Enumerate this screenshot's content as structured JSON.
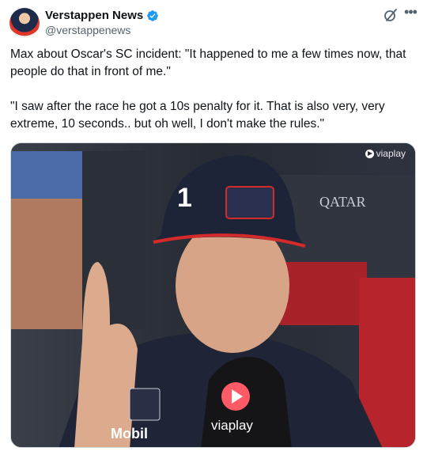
{
  "author": {
    "name": "Verstappen News",
    "handle": "@verstappenews",
    "verified": true
  },
  "icons": {
    "verified": "verified-badge-icon",
    "grok": "grok-icon",
    "more": "more-icon"
  },
  "colors": {
    "verified_blue": "#1d9bf0",
    "text_primary": "#0f1419",
    "text_secondary": "#536471"
  },
  "tweet": {
    "paragraph1": "Max about Oscar's SC incident: \"It happened to me a few times now, that people do that in front of me.\"",
    "paragraph2": "\"I saw after the race he got a 10s penalty for it. That is also very, very extreme, 10 seconds.. but oh well, I don't make the rules.\""
  },
  "media": {
    "watermark": "viaplay",
    "mic_label": "viaplay"
  }
}
